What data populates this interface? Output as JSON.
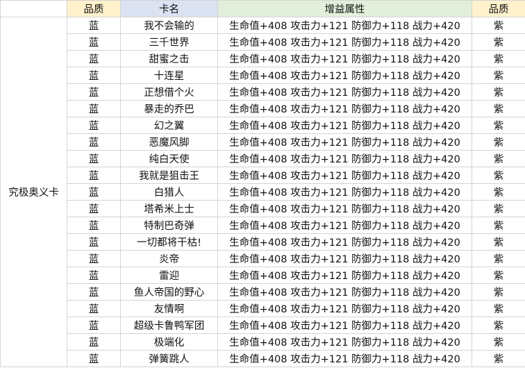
{
  "headers": {
    "quality": "品质",
    "card_name": "卡名",
    "bonus_attributes": "增益属性",
    "quality_right": "品质"
  },
  "category": "究极奥义卡",
  "rows": [
    {
      "quality": "蓝",
      "name": "我不会输的",
      "attr": "生命值+408 攻击力+121 防御力+118 战力+420",
      "quality_right": "紫"
    },
    {
      "quality": "蓝",
      "name": "三千世界",
      "attr": "生命值+408 攻击力+121 防御力+118 战力+420",
      "quality_right": "紫"
    },
    {
      "quality": "蓝",
      "name": "甜蜜之击",
      "attr": "生命值+408 攻击力+121 防御力+118 战力+420",
      "quality_right": "紫"
    },
    {
      "quality": "蓝",
      "name": "十连星",
      "attr": "生命值+408 攻击力+121 防御力+118 战力+420",
      "quality_right": "紫"
    },
    {
      "quality": "蓝",
      "name": "正想借个火",
      "attr": "生命值+408 攻击力+121 防御力+118 战力+420",
      "quality_right": "紫"
    },
    {
      "quality": "蓝",
      "name": "暴走的乔巴",
      "attr": "生命值+408 攻击力+121 防御力+118 战力+420",
      "quality_right": "紫"
    },
    {
      "quality": "蓝",
      "name": "幻之翼",
      "attr": "生命值+408 攻击力+121 防御力+118 战力+420",
      "quality_right": "紫"
    },
    {
      "quality": "蓝",
      "name": "恶魔风脚",
      "attr": "生命值+408 攻击力+121 防御力+118 战力+420",
      "quality_right": "紫"
    },
    {
      "quality": "蓝",
      "name": "纯白天使",
      "attr": "生命值+408 攻击力+121 防御力+118 战力+420",
      "quality_right": "紫"
    },
    {
      "quality": "蓝",
      "name": "我就是狙击王",
      "attr": "生命值+408 攻击力+121 防御力+118 战力+420",
      "quality_right": "紫"
    },
    {
      "quality": "蓝",
      "name": "白猎人",
      "attr": "生命值+408 攻击力+121 防御力+118 战力+420",
      "quality_right": "紫"
    },
    {
      "quality": "蓝",
      "name": "塔希米上士",
      "attr": "生命值+408 攻击力+121 防御力+118 战力+420",
      "quality_right": "紫"
    },
    {
      "quality": "蓝",
      "name": "特制巴奇弹",
      "attr": "生命值+408 攻击力+121 防御力+118 战力+420",
      "quality_right": "紫"
    },
    {
      "quality": "蓝",
      "name": "一切都将干枯!",
      "attr": "生命值+408 攻击力+121 防御力+118 战力+420",
      "quality_right": "紫"
    },
    {
      "quality": "蓝",
      "name": "炎帝",
      "attr": "生命值+408 攻击力+121 防御力+118 战力+420",
      "quality_right": "紫"
    },
    {
      "quality": "蓝",
      "name": "雷迎",
      "attr": "生命值+408 攻击力+121 防御力+118 战力+420",
      "quality_right": "紫"
    },
    {
      "quality": "蓝",
      "name": "鱼人帝国的野心",
      "attr": "生命值+408 攻击力+121 防御力+118 战力+420",
      "quality_right": "紫"
    },
    {
      "quality": "蓝",
      "name": "友情啊",
      "attr": "生命值+408 攻击力+121 防御力+118 战力+420",
      "quality_right": "紫"
    },
    {
      "quality": "蓝",
      "name": "超级卡鲁鸭军团",
      "attr": "生命值+408 攻击力+121 防御力+118 战力+420",
      "quality_right": "紫"
    },
    {
      "quality": "蓝",
      "name": "极端化",
      "attr": "生命值+408 攻击力+121 防御力+118 战力+420",
      "quality_right": "紫"
    },
    {
      "quality": "蓝",
      "name": "弹簧跳人",
      "attr": "生命值+408 攻击力+121 防御力+118 战力+420",
      "quality_right": "紫"
    }
  ]
}
